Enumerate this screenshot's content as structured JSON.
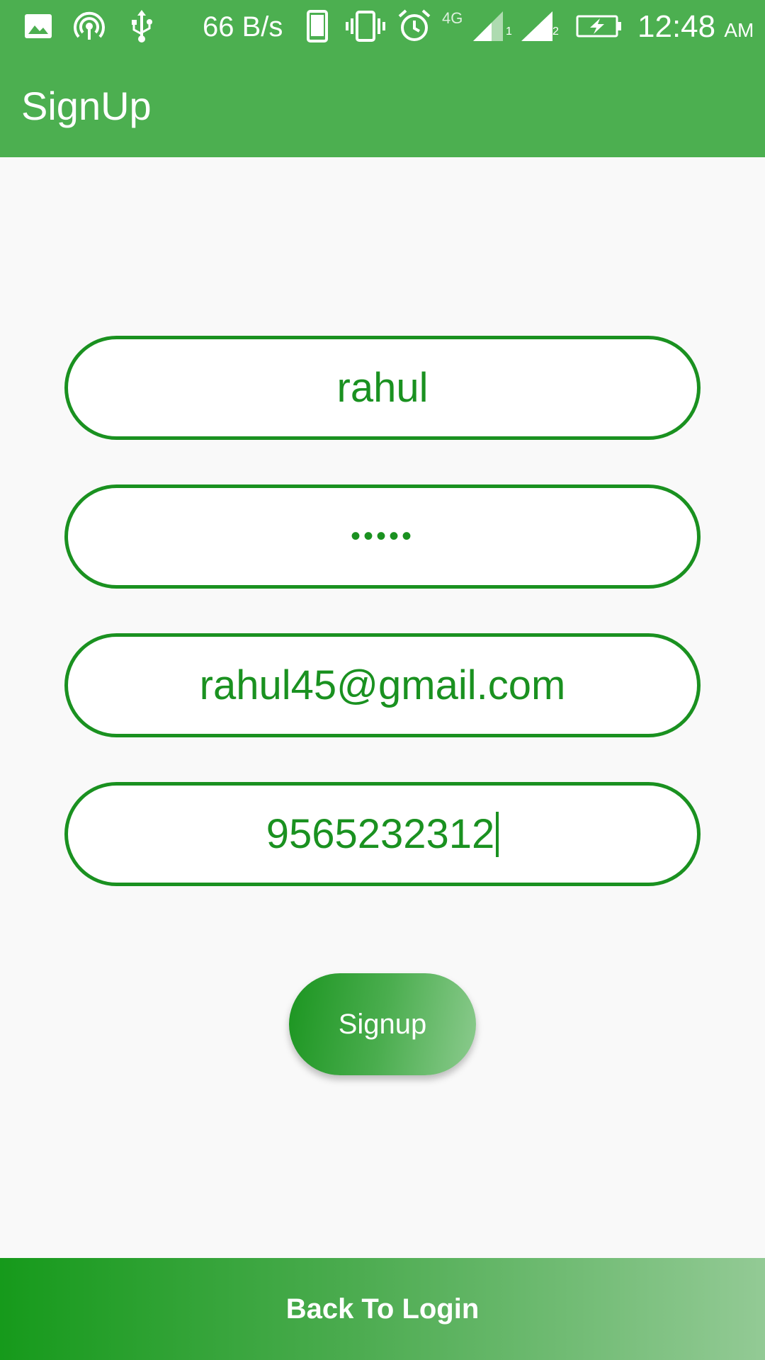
{
  "status_bar": {
    "net_speed": "66 B/s",
    "network_type": "4G",
    "sim1_label": "1",
    "sim2_label": "2",
    "time": "12:48",
    "ampm": "AM",
    "icons": [
      "gallery-icon",
      "hotspot-icon",
      "usb-icon",
      "phone-icon",
      "vibrate-icon",
      "alarm-icon",
      "signal-icon",
      "battery-charging-icon"
    ]
  },
  "appbar": {
    "title": "SignUp"
  },
  "form": {
    "name_value": "rahul",
    "password_value": "•••••",
    "email_value": "rahul45@gmail.com",
    "phone_value": "9565232312"
  },
  "actions": {
    "signup_label": "Signup",
    "back_to_login_label": "Back To Login"
  },
  "colors": {
    "appbar": "#4caf50",
    "accent": "#1a9120",
    "background": "#f9f9f9"
  }
}
